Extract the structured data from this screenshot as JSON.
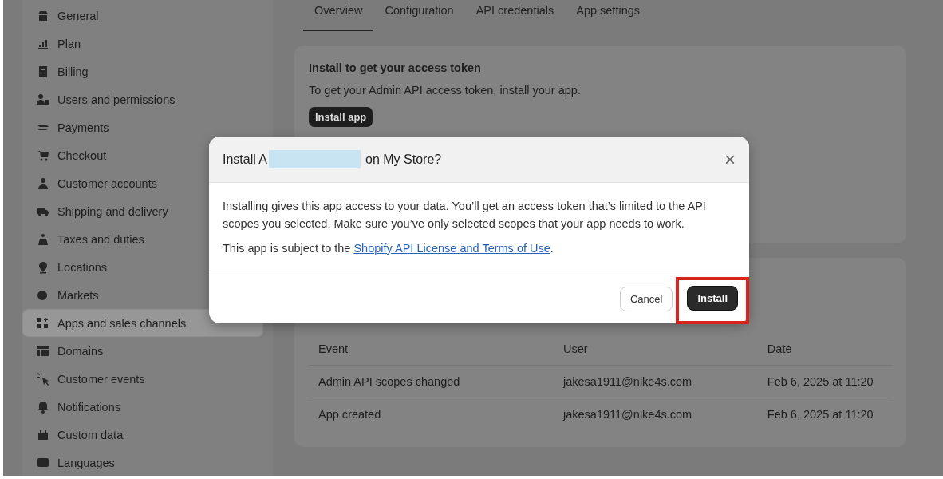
{
  "sidebar": {
    "items": [
      {
        "label": "General",
        "selected": false
      },
      {
        "label": "Plan",
        "selected": false
      },
      {
        "label": "Billing",
        "selected": false
      },
      {
        "label": "Users and permissions",
        "selected": false
      },
      {
        "label": "Payments",
        "selected": false
      },
      {
        "label": "Checkout",
        "selected": false
      },
      {
        "label": "Customer accounts",
        "selected": false
      },
      {
        "label": "Shipping and delivery",
        "selected": false
      },
      {
        "label": "Taxes and duties",
        "selected": false
      },
      {
        "label": "Locations",
        "selected": false
      },
      {
        "label": "Markets",
        "selected": false
      },
      {
        "label": "Apps and sales channels",
        "selected": true
      },
      {
        "label": "Domains",
        "selected": false
      },
      {
        "label": "Customer events",
        "selected": false
      },
      {
        "label": "Notifications",
        "selected": false
      },
      {
        "label": "Custom data",
        "selected": false
      },
      {
        "label": "Languages",
        "selected": false
      }
    ]
  },
  "tabs": [
    {
      "label": "Overview",
      "selected": true
    },
    {
      "label": "Configuration",
      "selected": false
    },
    {
      "label": "API credentials",
      "selected": false
    },
    {
      "label": "App settings",
      "selected": false
    }
  ],
  "install_card": {
    "title": "Install to get your access token",
    "text": "To get your Admin API access token, install your app.",
    "button": "Install app"
  },
  "history_table": {
    "columns": [
      "Event",
      "User",
      "Date"
    ],
    "rows": [
      [
        "Admin API scopes changed",
        "jakesa1911@nike4s.com",
        "Feb 6, 2025 at 11:20"
      ],
      [
        "App created",
        "jakesa1911@nike4s.com",
        "Feb 6, 2025 at 11:20"
      ]
    ]
  },
  "dialog": {
    "title_start": "Install A",
    "title_redacted": true,
    "title_end": "on My Store?",
    "close": "×",
    "body": "Installing gives this app access to your data. You’ll get an access token that’s limited to the API scopes you selected. Make sure you’ve only selected scopes that your app needs to work.",
    "terms_text": "This app is subject to the",
    "terms_link": "Shopify API License and Terms of Use",
    "terms_end": ".",
    "actions": [
      {
        "label": "Cancel",
        "kind": "secondary",
        "highlighted": false
      },
      {
        "label": "Install",
        "kind": "primary",
        "highlighted": true
      }
    ]
  }
}
